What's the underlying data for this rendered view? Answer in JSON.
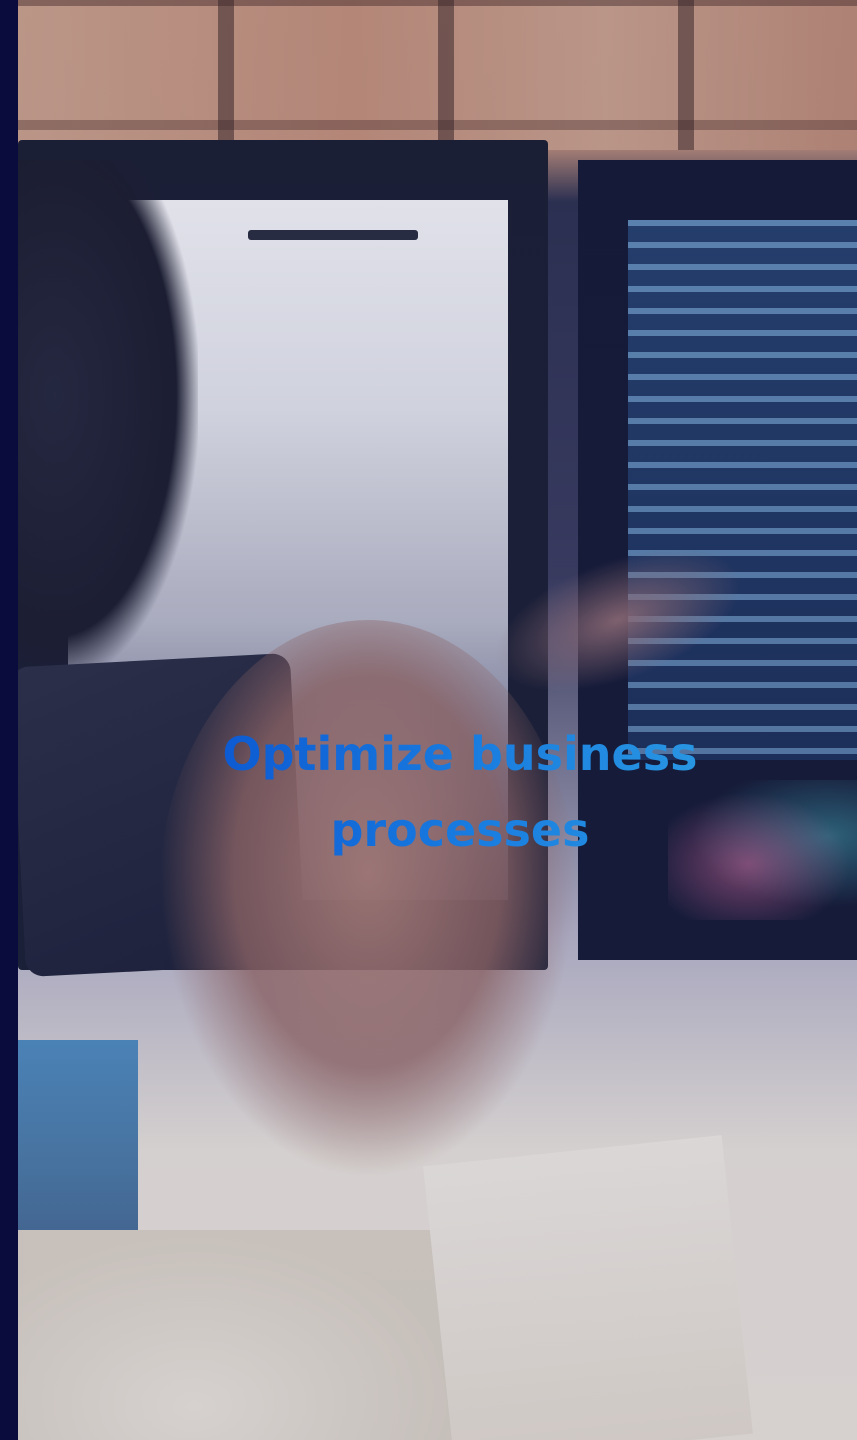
{
  "hero": {
    "headline": "Optimize business processes",
    "background_image": "person-pointing-at-monitors-photo"
  },
  "colors": {
    "headline_start": "#0b55d0",
    "headline_end": "#2b9ae2",
    "edge": "#0a0c3d"
  }
}
